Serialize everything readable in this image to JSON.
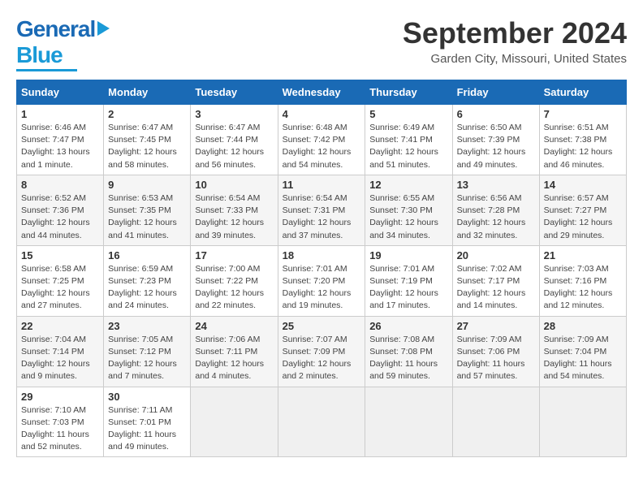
{
  "header": {
    "logo_general": "General",
    "logo_blue": "Blue",
    "month_title": "September 2024",
    "location": "Garden City, Missouri, United States"
  },
  "days_of_week": [
    "Sunday",
    "Monday",
    "Tuesday",
    "Wednesday",
    "Thursday",
    "Friday",
    "Saturday"
  ],
  "weeks": [
    [
      {
        "day": 1,
        "lines": [
          "Sunrise: 6:46 AM",
          "Sunset: 7:47 PM",
          "Daylight: 13 hours",
          "and 1 minute."
        ]
      },
      {
        "day": 2,
        "lines": [
          "Sunrise: 6:47 AM",
          "Sunset: 7:45 PM",
          "Daylight: 12 hours",
          "and 58 minutes."
        ]
      },
      {
        "day": 3,
        "lines": [
          "Sunrise: 6:47 AM",
          "Sunset: 7:44 PM",
          "Daylight: 12 hours",
          "and 56 minutes."
        ]
      },
      {
        "day": 4,
        "lines": [
          "Sunrise: 6:48 AM",
          "Sunset: 7:42 PM",
          "Daylight: 12 hours",
          "and 54 minutes."
        ]
      },
      {
        "day": 5,
        "lines": [
          "Sunrise: 6:49 AM",
          "Sunset: 7:41 PM",
          "Daylight: 12 hours",
          "and 51 minutes."
        ]
      },
      {
        "day": 6,
        "lines": [
          "Sunrise: 6:50 AM",
          "Sunset: 7:39 PM",
          "Daylight: 12 hours",
          "and 49 minutes."
        ]
      },
      {
        "day": 7,
        "lines": [
          "Sunrise: 6:51 AM",
          "Sunset: 7:38 PM",
          "Daylight: 12 hours",
          "and 46 minutes."
        ]
      }
    ],
    [
      {
        "day": 8,
        "lines": [
          "Sunrise: 6:52 AM",
          "Sunset: 7:36 PM",
          "Daylight: 12 hours",
          "and 44 minutes."
        ]
      },
      {
        "day": 9,
        "lines": [
          "Sunrise: 6:53 AM",
          "Sunset: 7:35 PM",
          "Daylight: 12 hours",
          "and 41 minutes."
        ]
      },
      {
        "day": 10,
        "lines": [
          "Sunrise: 6:54 AM",
          "Sunset: 7:33 PM",
          "Daylight: 12 hours",
          "and 39 minutes."
        ]
      },
      {
        "day": 11,
        "lines": [
          "Sunrise: 6:54 AM",
          "Sunset: 7:31 PM",
          "Daylight: 12 hours",
          "and 37 minutes."
        ]
      },
      {
        "day": 12,
        "lines": [
          "Sunrise: 6:55 AM",
          "Sunset: 7:30 PM",
          "Daylight: 12 hours",
          "and 34 minutes."
        ]
      },
      {
        "day": 13,
        "lines": [
          "Sunrise: 6:56 AM",
          "Sunset: 7:28 PM",
          "Daylight: 12 hours",
          "and 32 minutes."
        ]
      },
      {
        "day": 14,
        "lines": [
          "Sunrise: 6:57 AM",
          "Sunset: 7:27 PM",
          "Daylight: 12 hours",
          "and 29 minutes."
        ]
      }
    ],
    [
      {
        "day": 15,
        "lines": [
          "Sunrise: 6:58 AM",
          "Sunset: 7:25 PM",
          "Daylight: 12 hours",
          "and 27 minutes."
        ]
      },
      {
        "day": 16,
        "lines": [
          "Sunrise: 6:59 AM",
          "Sunset: 7:23 PM",
          "Daylight: 12 hours",
          "and 24 minutes."
        ]
      },
      {
        "day": 17,
        "lines": [
          "Sunrise: 7:00 AM",
          "Sunset: 7:22 PM",
          "Daylight: 12 hours",
          "and 22 minutes."
        ]
      },
      {
        "day": 18,
        "lines": [
          "Sunrise: 7:01 AM",
          "Sunset: 7:20 PM",
          "Daylight: 12 hours",
          "and 19 minutes."
        ]
      },
      {
        "day": 19,
        "lines": [
          "Sunrise: 7:01 AM",
          "Sunset: 7:19 PM",
          "Daylight: 12 hours",
          "and 17 minutes."
        ]
      },
      {
        "day": 20,
        "lines": [
          "Sunrise: 7:02 AM",
          "Sunset: 7:17 PM",
          "Daylight: 12 hours",
          "and 14 minutes."
        ]
      },
      {
        "day": 21,
        "lines": [
          "Sunrise: 7:03 AM",
          "Sunset: 7:16 PM",
          "Daylight: 12 hours",
          "and 12 minutes."
        ]
      }
    ],
    [
      {
        "day": 22,
        "lines": [
          "Sunrise: 7:04 AM",
          "Sunset: 7:14 PM",
          "Daylight: 12 hours",
          "and 9 minutes."
        ]
      },
      {
        "day": 23,
        "lines": [
          "Sunrise: 7:05 AM",
          "Sunset: 7:12 PM",
          "Daylight: 12 hours",
          "and 7 minutes."
        ]
      },
      {
        "day": 24,
        "lines": [
          "Sunrise: 7:06 AM",
          "Sunset: 7:11 PM",
          "Daylight: 12 hours",
          "and 4 minutes."
        ]
      },
      {
        "day": 25,
        "lines": [
          "Sunrise: 7:07 AM",
          "Sunset: 7:09 PM",
          "Daylight: 12 hours",
          "and 2 minutes."
        ]
      },
      {
        "day": 26,
        "lines": [
          "Sunrise: 7:08 AM",
          "Sunset: 7:08 PM",
          "Daylight: 11 hours",
          "and 59 minutes."
        ]
      },
      {
        "day": 27,
        "lines": [
          "Sunrise: 7:09 AM",
          "Sunset: 7:06 PM",
          "Daylight: 11 hours",
          "and 57 minutes."
        ]
      },
      {
        "day": 28,
        "lines": [
          "Sunrise: 7:09 AM",
          "Sunset: 7:04 PM",
          "Daylight: 11 hours",
          "and 54 minutes."
        ]
      }
    ],
    [
      {
        "day": 29,
        "lines": [
          "Sunrise: 7:10 AM",
          "Sunset: 7:03 PM",
          "Daylight: 11 hours",
          "and 52 minutes."
        ]
      },
      {
        "day": 30,
        "lines": [
          "Sunrise: 7:11 AM",
          "Sunset: 7:01 PM",
          "Daylight: 11 hours",
          "and 49 minutes."
        ]
      },
      null,
      null,
      null,
      null,
      null
    ]
  ]
}
